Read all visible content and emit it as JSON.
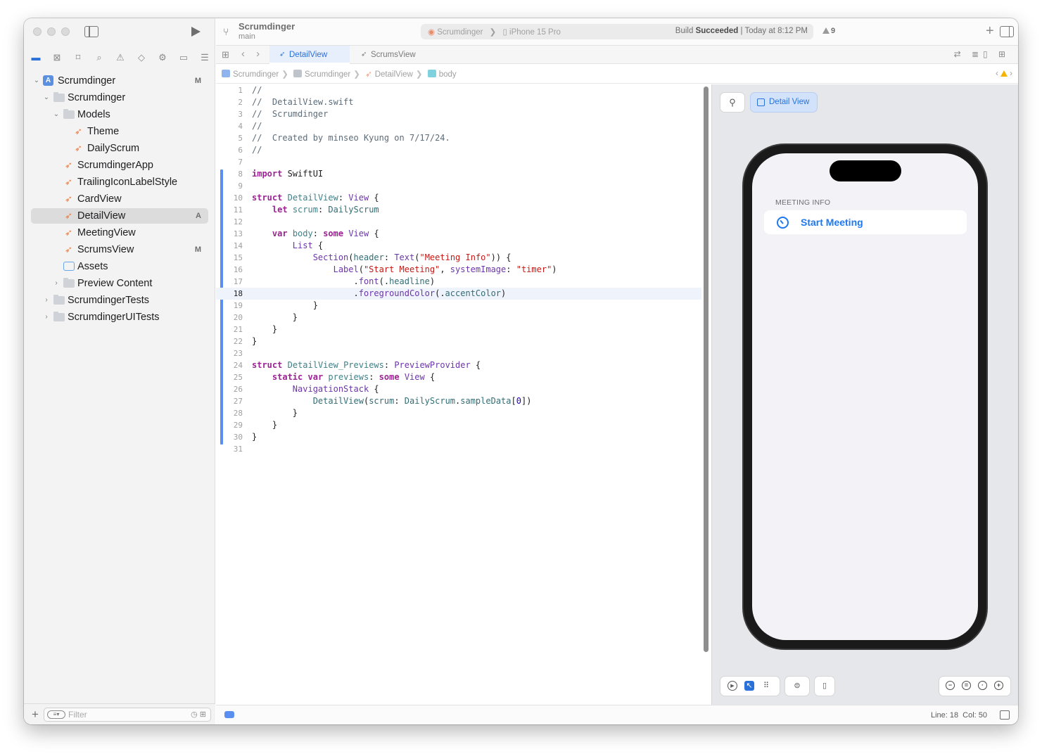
{
  "toolbar": {
    "project_name": "Scrumdinger",
    "branch": "main",
    "scheme": "Scrumdinger",
    "destination": "iPhone 15 Pro",
    "build_status_prefix": "Build",
    "build_status_strong": "Succeeded",
    "build_status_time": "| Today at 8:12 PM",
    "warning_count": "9"
  },
  "navigator": {
    "filter_placeholder": "Filter",
    "items": [
      {
        "label": "Scrumdinger",
        "badge": "M"
      },
      {
        "label": "Scrumdinger",
        "badge": ""
      },
      {
        "label": "Models",
        "badge": ""
      },
      {
        "label": "Theme",
        "badge": ""
      },
      {
        "label": "DailyScrum",
        "badge": ""
      },
      {
        "label": "ScrumdingerApp",
        "badge": ""
      },
      {
        "label": "TrailingIconLabelStyle",
        "badge": ""
      },
      {
        "label": "CardView",
        "badge": ""
      },
      {
        "label": "DetailView",
        "badge": "A"
      },
      {
        "label": "MeetingView",
        "badge": ""
      },
      {
        "label": "ScrumsView",
        "badge": "M"
      },
      {
        "label": "Assets",
        "badge": ""
      },
      {
        "label": "Preview Content",
        "badge": ""
      },
      {
        "label": "ScrumdingerTests",
        "badge": ""
      },
      {
        "label": "ScrumdingerUITests",
        "badge": ""
      }
    ]
  },
  "tabs": {
    "active": "DetailView",
    "inactive": "ScrumsView"
  },
  "jumpbar": {
    "crumbs": [
      "Scrumdinger",
      "Scrumdinger",
      "DetailView",
      "body"
    ]
  },
  "editor": {
    "current_line": 18,
    "line_count": 31
  },
  "preview": {
    "detail_view_label": "Detail View",
    "section_header": "MEETING INFO",
    "cell_label": "Start Meeting"
  },
  "statusbar": {
    "line": "Line: 18",
    "col": "Col: 50"
  },
  "colors": {
    "accent": "#2a71d9",
    "ios_tint": "#1e78f0",
    "keyword": "#9b2393",
    "string": "#c41a16"
  }
}
